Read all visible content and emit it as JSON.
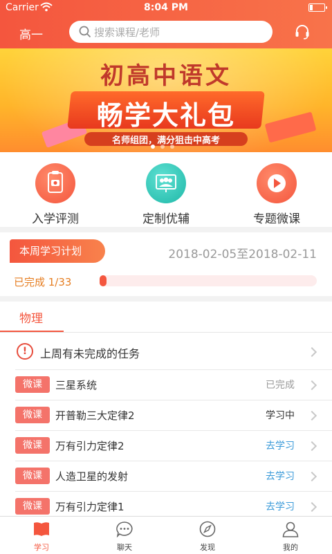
{
  "status_bar": {
    "carrier": "Carrier",
    "time": "8:04 PM"
  },
  "header": {
    "grade": "高一",
    "search_placeholder": "搜索课程/老师"
  },
  "banner": {
    "title": "初高中语文",
    "headline": "畅学大礼包",
    "subtitle": "名师组团，满分狙击中高考"
  },
  "quick_actions": [
    {
      "label": "入学评测",
      "icon": "clipboard-camera-icon",
      "color": "#f4563e"
    },
    {
      "label": "定制优辅",
      "icon": "group-screen-icon",
      "color": "#2ec4b6"
    },
    {
      "label": "专题微课",
      "icon": "play-icon",
      "color": "#f4563e"
    }
  ],
  "plan": {
    "tag": "本周学习计划",
    "date_range": "2018-02-05至2018-02-11",
    "completed_label": "已完成 1/33",
    "progress_fraction": 0.03
  },
  "subject": {
    "name": "物理"
  },
  "warning": {
    "text": "上周有未完成的任务"
  },
  "lessons": [
    {
      "tag": "微课",
      "title": "三星系统",
      "status": "已完成",
      "status_color": "#999999"
    },
    {
      "tag": "微课",
      "title": "开普勒三大定律2",
      "status": "学习中",
      "status_color": "#333333"
    },
    {
      "tag": "微课",
      "title": "万有引力定律2",
      "status": "去学习",
      "status_color": "#3a9ad9"
    },
    {
      "tag": "微课",
      "title": "人造卫星的发射",
      "status": "去学习",
      "status_color": "#3a9ad9"
    },
    {
      "tag": "微课",
      "title": "万有引力定律1",
      "status": "去学习",
      "status_color": "#3a9ad9"
    }
  ],
  "tabs": [
    {
      "label": "学习",
      "icon": "book-icon",
      "active": true
    },
    {
      "label": "聊天",
      "icon": "chat-icon",
      "active": false
    },
    {
      "label": "发现",
      "icon": "compass-icon",
      "active": false
    },
    {
      "label": "我的",
      "icon": "user-icon",
      "active": false
    }
  ],
  "colors": {
    "accent": "#f4563e",
    "link": "#3a9ad9"
  }
}
